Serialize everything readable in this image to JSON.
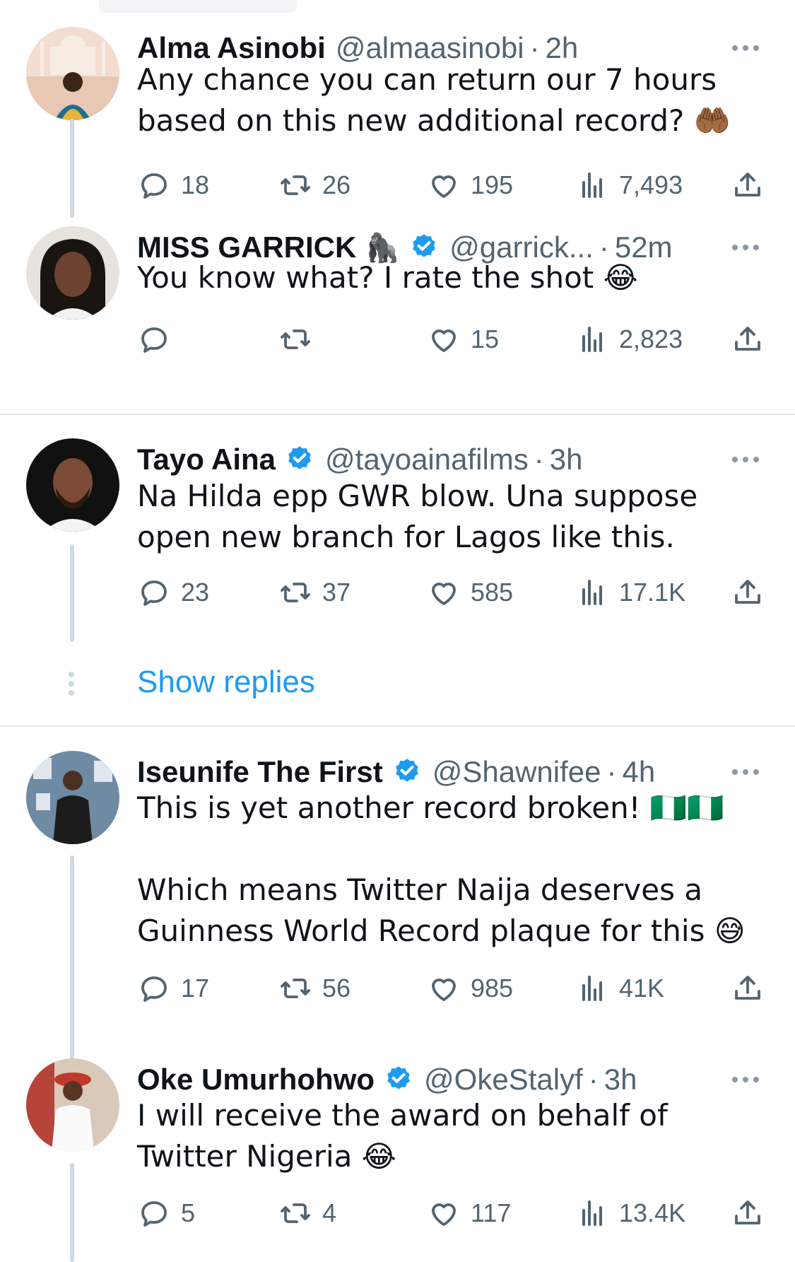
{
  "tweets": [
    {
      "name": "Alma Asinobi",
      "name_emoji": "",
      "verified": false,
      "handle": "@almaasinobi",
      "time": "2h",
      "text": "Any chance you can return our 7 hours\nbased on this new additional record? 🤲🏾",
      "replies": "18",
      "retweets": "26",
      "likes": "195",
      "views": "7,493"
    },
    {
      "name": "MISS GARRICK",
      "name_emoji": "🦍",
      "verified": true,
      "handle": "@garrick...",
      "time": "52m",
      "text": "You know what? I rate the shot 😂",
      "replies": "",
      "retweets": "",
      "likes": "15",
      "views": "2,823"
    },
    {
      "name": "Tayo Aina",
      "name_emoji": "",
      "verified": true,
      "handle": "@tayoainafilms",
      "time": "3h",
      "text": "Na Hilda epp GWR blow. Una suppose\nopen new branch for Lagos like this.",
      "replies": "23",
      "retweets": "37",
      "likes": "585",
      "views": "17.1K"
    },
    {
      "name": "Iseunife The First",
      "name_emoji": "",
      "verified": true,
      "handle": "@Shawnifee",
      "time": "4h",
      "text": "This is yet another record broken! 🇳🇬🇳🇬\n\nWhich means Twitter Naija deserves a\nGuinness World Record plaque for this 😅",
      "replies": "17",
      "retweets": "56",
      "likes": "985",
      "views": "41K"
    },
    {
      "name": "Oke Umurhohwo",
      "name_emoji": "",
      "verified": true,
      "handle": "@OkeStalyf",
      "time": "3h",
      "text": "I will receive the award on behalf of\nTwitter Nigeria 😂",
      "replies": "5",
      "retweets": "4",
      "likes": "117",
      "views": "13.4K"
    }
  ],
  "show_replies": "Show replies",
  "separator": "·",
  "colors": {
    "link_blue": "#1d9bf0",
    "secondary_text": "#536471",
    "thread_line": "#cfd9de",
    "divider": "#e1e8ed"
  },
  "icons": [
    "reply-icon",
    "retweet-icon",
    "like-icon",
    "views-icon",
    "share-icon",
    "more-icon",
    "verified-icon"
  ]
}
